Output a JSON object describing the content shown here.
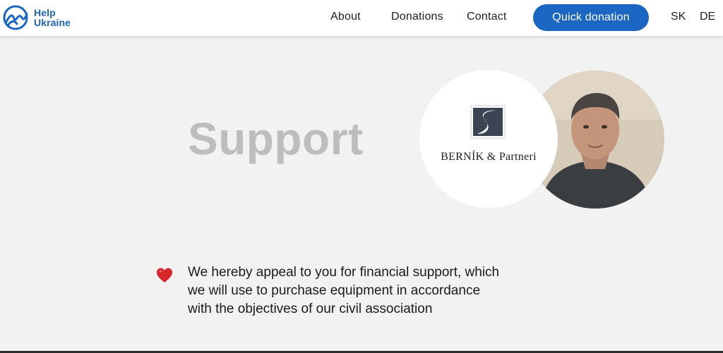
{
  "header": {
    "logo": {
      "line1": "Help",
      "line2": "Ukraine"
    },
    "nav": [
      {
        "label": "About"
      },
      {
        "label": "Donations"
      },
      {
        "label": "Contact"
      }
    ],
    "cta_label": "Quick donation",
    "languages": [
      "SK",
      "DE"
    ]
  },
  "main": {
    "title": "Support",
    "partner": {
      "name": "BERNÍK & Partneri"
    },
    "appeal": {
      "icon": "heart-icon",
      "lines": [
        "We hereby appeal to you for financial support, which",
        "we will use to purchase equipment in accordance",
        "with the objectives of our civil association"
      ]
    }
  },
  "colors": {
    "brand_blue": "#1a66c0",
    "title_gray": "#bdbdbd",
    "background": "#f2f2f2",
    "heart_red": "#d7262b"
  }
}
